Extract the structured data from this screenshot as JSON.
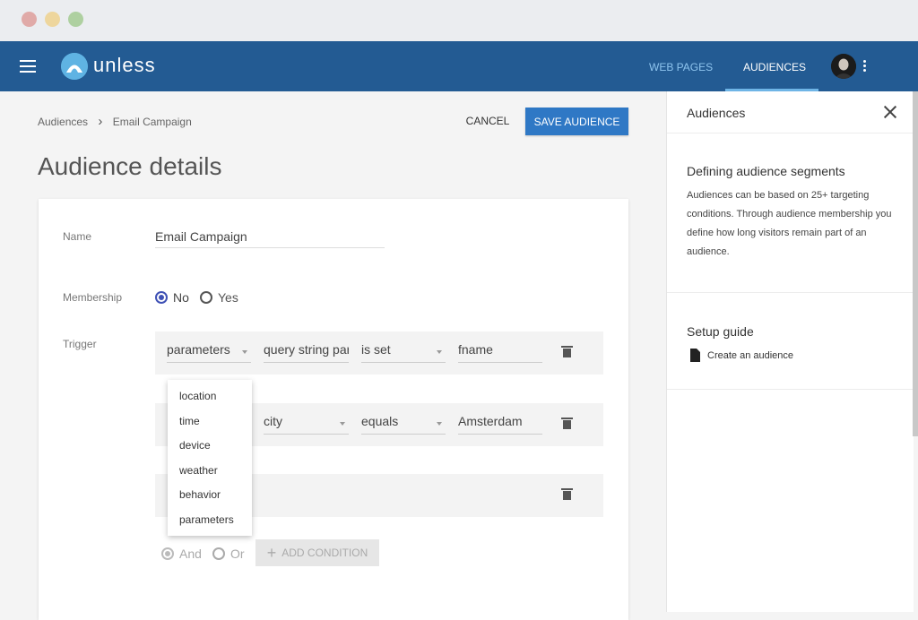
{
  "app": {
    "logo_text": "unless"
  },
  "nav": {
    "web_pages": "WEB PAGES",
    "audiences": "AUDIENCES"
  },
  "breadcrumb": {
    "root": "Audiences",
    "separator": "›",
    "current": "Email Campaign"
  },
  "actions": {
    "cancel": "CANCEL",
    "save": "SAVE AUDIENCE"
  },
  "page": {
    "title": "Audience details"
  },
  "form": {
    "name_label": "Name",
    "name_value": "Email Campaign",
    "membership_label": "Membership",
    "membership_options": [
      "No",
      "Yes"
    ],
    "membership_selected": "No",
    "trigger_label": "Trigger"
  },
  "trigger_rows": [
    {
      "type": "parameters",
      "field": "query string par",
      "operator": "is set",
      "value": "fname"
    },
    {
      "type": "",
      "field": "city",
      "operator": "equals",
      "value": "Amsterdam"
    },
    {
      "type": "",
      "field": "",
      "operator": "",
      "value": ""
    }
  ],
  "dropdown": {
    "options": [
      "location",
      "time",
      "device",
      "weather",
      "behavior",
      "parameters"
    ]
  },
  "logic": {
    "and": "And",
    "or": "Or",
    "selected": "And",
    "add_condition": "ADD CONDITION"
  },
  "side_panel": {
    "title": "Audiences",
    "section1_heading": "Defining audience segments",
    "section1_text": "Audiences can be based on 25+ targeting conditions. Through audience membership you define how long visitors remain part of an audience.",
    "section2_heading": "Setup guide",
    "link_text": "Create an audience"
  },
  "colors": {
    "topbar": "#235b93",
    "primary_button": "#2f78c5",
    "radio_accent": "#3f51b5",
    "nav_underline": "#6fb5e6"
  },
  "icons": [
    "menu-icon",
    "unless-logo-icon",
    "kebab-menu-icon",
    "chevron-right-icon",
    "chevron-down-icon",
    "trash-icon",
    "plus-icon",
    "close-icon",
    "document-icon"
  ]
}
